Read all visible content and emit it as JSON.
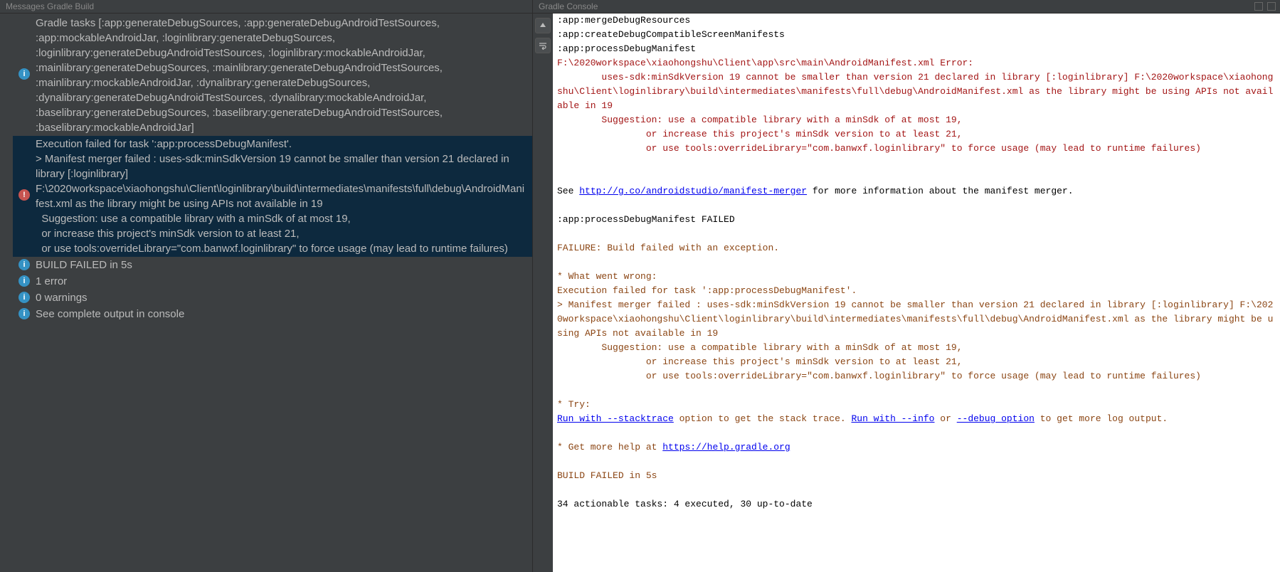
{
  "left": {
    "title": "Messages Gradle Build",
    "messages": [
      {
        "icon": "info",
        "text": "Gradle tasks [:app:generateDebugSources, :app:generateDebugAndroidTestSources, :app:mockableAndroidJar, :loginlibrary:generateDebugSources, :loginlibrary:generateDebugAndroidTestSources, :loginlibrary:mockableAndroidJar, :mainlibrary:generateDebugSources, :mainlibrary:generateDebugAndroidTestSources, :mainlibrary:mockableAndroidJar, :dynalibrary:generateDebugSources, :dynalibrary:generateDebugAndroidTestSources, :dynalibrary:mockableAndroidJar, :baselibrary:generateDebugSources, :baselibrary:generateDebugAndroidTestSources, :baselibrary:mockableAndroidJar]"
      },
      {
        "icon": "error",
        "selected": true,
        "text": "Execution failed for task ':app:processDebugManifest'.\n> Manifest merger failed : uses-sdk:minSdkVersion 19 cannot be smaller than version 21 declared in library [:loginlibrary] F:\\2020workspace\\xiaohongshu\\Client\\loginlibrary\\build\\intermediates\\manifests\\full\\debug\\AndroidManifest.xml as the library might be using APIs not available in 19\n  Suggestion: use a compatible library with a minSdk of at most 19,\n  or increase this project's minSdk version to at least 21,\n  or use tools:overrideLibrary=\"com.banwxf.loginlibrary\" to force usage (may lead to runtime failures)"
      },
      {
        "icon": "info",
        "text": "BUILD FAILED in 5s"
      },
      {
        "icon": "info",
        "text": "1 error"
      },
      {
        "icon": "info",
        "text": "0 warnings"
      },
      {
        "icon": "info",
        "text": "See complete output in console"
      }
    ]
  },
  "right": {
    "title": "Gradle Console",
    "tool_icons": [
      "arrow-up-icon",
      "wrap-icon"
    ],
    "lines": [
      {
        "text": ":app:mergeDebugResources",
        "cls": "c-black"
      },
      {
        "text": ":app:createDebugCompatibleScreenManifests",
        "cls": "c-black"
      },
      {
        "text": ":app:processDebugManifest",
        "cls": "c-black"
      },
      {
        "text": "F:\\2020workspace\\xiaohongshu\\Client\\app\\src\\main\\AndroidManifest.xml Error:",
        "cls": "c-red"
      },
      {
        "text": "\tuses-sdk:minSdkVersion 19 cannot be smaller than version 21 declared in library [:loginlibrary] F:\\2020workspace\\xiaohongshu\\Client\\loginlibrary\\build\\intermediates\\manifests\\full\\debug\\AndroidManifest.xml as the library might be using APIs not available in 19",
        "cls": "c-red"
      },
      {
        "text": "\tSuggestion: use a compatible library with a minSdk of at most 19,",
        "cls": "c-red"
      },
      {
        "text": "\t\tor increase this project's minSdk version to at least 21,",
        "cls": "c-red"
      },
      {
        "text": "\t\tor use tools:overrideLibrary=\"com.banwxf.loginlibrary\" to force usage (may lead to runtime failures)",
        "cls": "c-red"
      },
      {
        "text": "",
        "cls": "c-black"
      },
      {
        "text": "",
        "cls": "c-black"
      },
      {
        "segments": [
          {
            "text": "See ",
            "cls": "c-black"
          },
          {
            "text": "http://g.co/androidstudio/manifest-merger",
            "cls": "c-blue",
            "name": "link-manifest-merger"
          },
          {
            "text": " for more information about the manifest merger.",
            "cls": "c-black"
          }
        ]
      },
      {
        "text": "",
        "cls": "c-black"
      },
      {
        "text": ":app:processDebugManifest FAILED",
        "cls": "c-black"
      },
      {
        "text": "",
        "cls": "c-black"
      },
      {
        "text": "FAILURE: Build failed with an exception.",
        "cls": "c-brown"
      },
      {
        "text": "",
        "cls": "c-black"
      },
      {
        "text": "* What went wrong:",
        "cls": "c-brown"
      },
      {
        "text": "Execution failed for task ':app:processDebugManifest'.",
        "cls": "c-brown"
      },
      {
        "text": "> Manifest merger failed : uses-sdk:minSdkVersion 19 cannot be smaller than version 21 declared in library [:loginlibrary] F:\\2020workspace\\xiaohongshu\\Client\\loginlibrary\\build\\intermediates\\manifests\\full\\debug\\AndroidManifest.xml as the library might be using APIs not available in 19",
        "cls": "c-brown"
      },
      {
        "text": "  \tSuggestion: use a compatible library with a minSdk of at most 19,",
        "cls": "c-brown"
      },
      {
        "text": "  \t\tor increase this project's minSdk version to at least 21,",
        "cls": "c-brown"
      },
      {
        "text": "  \t\tor use tools:overrideLibrary=\"com.banwxf.loginlibrary\" to force usage (may lead to runtime failures)",
        "cls": "c-brown"
      },
      {
        "text": "",
        "cls": "c-black"
      },
      {
        "text": "* Try:",
        "cls": "c-brown"
      },
      {
        "segments": [
          {
            "text": "Run with --stacktrace",
            "cls": "c-blue",
            "name": "link-stacktrace"
          },
          {
            "text": " option to get the stack trace. ",
            "cls": "c-brown"
          },
          {
            "text": "Run with --info",
            "cls": "c-blue",
            "name": "link-info"
          },
          {
            "text": " or ",
            "cls": "c-brown"
          },
          {
            "text": "--debug option",
            "cls": "c-blue",
            "name": "link-debug"
          },
          {
            "text": " to get more log output.",
            "cls": "c-brown"
          }
        ]
      },
      {
        "text": "",
        "cls": "c-black"
      },
      {
        "segments": [
          {
            "text": "* Get more help at ",
            "cls": "c-brown"
          },
          {
            "text": "https://help.gradle.org",
            "cls": "c-blue",
            "name": "link-help-gradle"
          }
        ]
      },
      {
        "text": "",
        "cls": "c-black"
      },
      {
        "text": "BUILD FAILED in 5s",
        "cls": "c-brown"
      },
      {
        "text": "",
        "cls": "c-black"
      },
      {
        "text": "34 actionable tasks: 4 executed, 30 up-to-date",
        "cls": "c-black"
      }
    ]
  }
}
